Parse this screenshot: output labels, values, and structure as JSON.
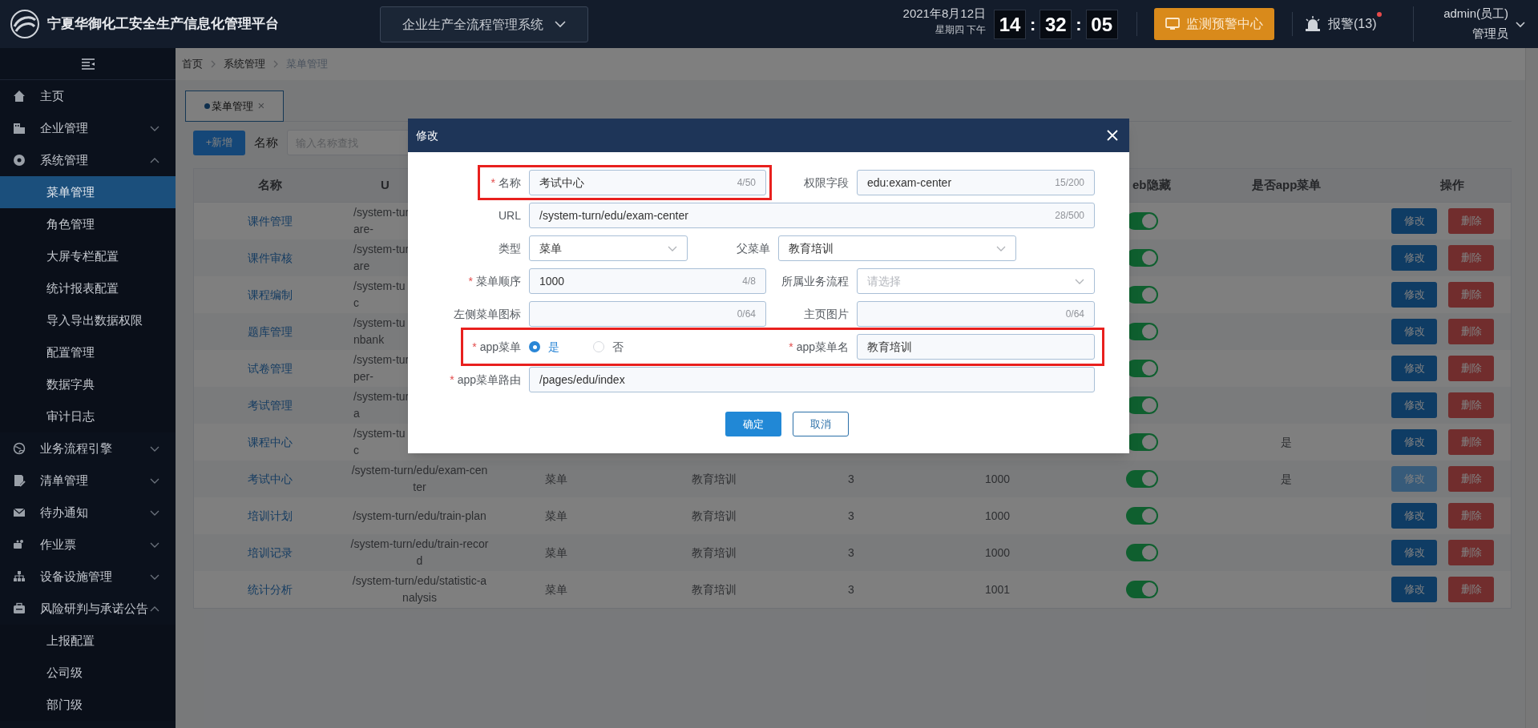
{
  "header": {
    "title": "宁夏华御化工安全生产信息化管理平台",
    "system_select": {
      "value": "企业生产全流程管理系统"
    },
    "date": "2021年8月12日",
    "weekday": "星期四 下午",
    "clock": [
      {
        "kind": "digits",
        "text": "14"
      },
      {
        "kind": "separator",
        "text": ":"
      },
      {
        "kind": "digits",
        "text": "32"
      },
      {
        "kind": "separator",
        "text": ":"
      },
      {
        "kind": "digits",
        "text": "05"
      }
    ],
    "monitor_button": "监测预警中心",
    "alarm": {
      "label": "报警(13)",
      "unread": true
    },
    "user": {
      "name": "admin(员工)",
      "role": "管理员"
    }
  },
  "sidebar": {
    "items": [
      {
        "label": "主页",
        "kind": "link"
      },
      {
        "label": "企业管理",
        "kind": "group",
        "expanded": false
      },
      {
        "label": "系统管理",
        "kind": "group",
        "expanded": true,
        "children": [
          {
            "label": "菜单管理",
            "selected": true
          },
          {
            "label": "角色管理",
            "selected": false
          },
          {
            "label": "大屏专栏配置",
            "selected": false
          },
          {
            "label": "统计报表配置",
            "selected": false
          },
          {
            "label": "导入导出数据权限",
            "selected": false
          },
          {
            "label": "配置管理",
            "selected": false
          },
          {
            "label": "数据字典",
            "selected": false
          },
          {
            "label": "审计日志",
            "selected": false
          }
        ]
      },
      {
        "label": "业务流程引擎",
        "kind": "group",
        "expanded": false
      },
      {
        "label": "清单管理",
        "kind": "group",
        "expanded": false
      },
      {
        "label": "待办通知",
        "kind": "group",
        "expanded": false
      },
      {
        "label": "作业票",
        "kind": "group",
        "expanded": false
      },
      {
        "label": "设备设施管理",
        "kind": "group",
        "expanded": false
      },
      {
        "label": "风险研判与承诺公告",
        "kind": "group",
        "expanded": true,
        "children": [
          {
            "label": "上报配置",
            "selected": false
          },
          {
            "label": "公司级",
            "selected": false
          },
          {
            "label": "部门级",
            "selected": false
          }
        ]
      }
    ]
  },
  "breadcrumb": [
    "首页",
    "系统管理",
    "菜单管理"
  ],
  "tabs": [
    {
      "label": "菜单管理",
      "selected": true,
      "close": "×"
    }
  ],
  "toolbar": {
    "add_button": "+新增",
    "search_label": "名称",
    "search_placeholder": "输入名称查找"
  },
  "table": {
    "columns": [
      "名称",
      "U",
      null,
      null,
      null,
      null,
      "eb隐藏",
      "是否app菜单",
      "操作"
    ],
    "rows": [
      {
        "name": "课件管理",
        "url_lines": [
          "/system-tur",
          "are-"
        ],
        "switch_on": true,
        "edit_hovered": false,
        "actions": [
          "修改",
          "删除"
        ]
      },
      {
        "name": "课件审核",
        "url_lines": [
          "/system-tur",
          "are"
        ],
        "switch_on": true,
        "edit_hovered": false,
        "actions": [
          "修改",
          "删除"
        ]
      },
      {
        "name": "课程编制",
        "url_lines": [
          "/system-tu",
          "c"
        ],
        "switch_on": true,
        "edit_hovered": false,
        "actions": [
          "修改",
          "删除"
        ]
      },
      {
        "name": "题库管理",
        "url_lines": [
          "/system-tu",
          "nbank"
        ],
        "switch_on": true,
        "edit_hovered": false,
        "actions": [
          "修改",
          "删除"
        ]
      },
      {
        "name": "试卷管理",
        "url_lines": [
          "/system-tur",
          "per-"
        ],
        "switch_on": true,
        "edit_hovered": false,
        "actions": [
          "修改",
          "删除"
        ]
      },
      {
        "name": "考试管理",
        "url_lines": [
          "/system-tur",
          "a"
        ],
        "switch_on": true,
        "edit_hovered": false,
        "actions": [
          "修改",
          "删除"
        ]
      },
      {
        "name": "课程中心",
        "url_lines": [
          "/system-tu",
          "c"
        ],
        "switch_on": true,
        "app_menu": "是",
        "edit_hovered": false,
        "actions": [
          "修改",
          "删除"
        ]
      },
      {
        "name": "考试中心",
        "url": "/system-turn/edu/exam-center",
        "column_3": "菜单",
        "column_4": "教育培训",
        "column_5": "3",
        "column_6": "1000",
        "switch_on": true,
        "app_menu": "是",
        "edit_hovered": true,
        "actions": [
          "修改",
          "删除"
        ]
      },
      {
        "name": "培训计划",
        "url": "/system-turn/edu/train-plan",
        "column_3": "菜单",
        "column_4": "教育培训",
        "column_5": "3",
        "column_6": "1000",
        "switch_on": true,
        "edit_hovered": false,
        "actions": [
          "修改",
          "删除"
        ]
      },
      {
        "name": "培训记录",
        "url": "/system-turn/edu/train-record",
        "column_3": "菜单",
        "column_4": "教育培训",
        "column_5": "3",
        "column_6": "1000",
        "switch_on": true,
        "edit_hovered": false,
        "actions": [
          "修改",
          "删除"
        ]
      },
      {
        "name": "统计分析",
        "url": "/system-turn/edu/statistic-analysis",
        "column_3": "菜单",
        "column_4": "教育培训",
        "column_5": "3",
        "column_6": "1001",
        "switch_on": true,
        "edit_hovered": false,
        "actions": [
          "修改",
          "删除"
        ]
      }
    ]
  },
  "dialog": {
    "title": "修改",
    "rows": [
      {
        "fields": [
          {
            "label": "名称",
            "required_mark": "*",
            "highlighted": true,
            "kind": "text",
            "value": "考试中心",
            "counter": "4/50"
          },
          {
            "label": "权限字段",
            "highlighted": false,
            "kind": "text",
            "value": "edu:exam-center",
            "counter": "15/200"
          }
        ]
      },
      {
        "fields": [
          {
            "label": "URL",
            "highlighted": false,
            "kind": "text",
            "value": "/system-turn/edu/exam-center",
            "counter": "28/500"
          }
        ]
      },
      {
        "fields": [
          {
            "label": "类型",
            "highlighted": false,
            "kind": "select",
            "value": "菜单"
          },
          {
            "label": "父菜单",
            "highlighted": false,
            "kind": "select",
            "value": "教育培训"
          }
        ]
      },
      {
        "fields": [
          {
            "label": "菜单顺序",
            "required_mark": "*",
            "highlighted": false,
            "kind": "text",
            "value": "1000",
            "counter": "4/8"
          },
          {
            "label": "所属业务流程",
            "highlighted": false,
            "kind": "select",
            "placeholder": "请选择"
          }
        ]
      },
      {
        "fields": [
          {
            "label": "左侧菜单图标",
            "highlighted": false,
            "kind": "text",
            "counter": "0/64"
          },
          {
            "label": "主页图片",
            "highlighted": false,
            "kind": "text",
            "counter": "0/64"
          }
        ]
      },
      {
        "fields": [
          {
            "label": "app菜单",
            "required_mark": "*",
            "highlighted": true,
            "kind": "radio",
            "options": [
              {
                "label": "是",
                "selected": true
              },
              {
                "label": "否",
                "selected": false
              }
            ]
          },
          {
            "label": "app菜单名",
            "required_mark": "*",
            "highlighted": true,
            "kind": "text",
            "value": "教育培训"
          }
        ]
      },
      {
        "fields": [
          {
            "label": "app菜单路由",
            "required_mark": "*",
            "highlighted": false,
            "kind": "text",
            "value": "/pages/edu/index"
          }
        ]
      }
    ],
    "buttons": [
      {
        "label": "确定",
        "kind": "primary"
      },
      {
        "label": "取消",
        "kind": "default"
      }
    ]
  }
}
